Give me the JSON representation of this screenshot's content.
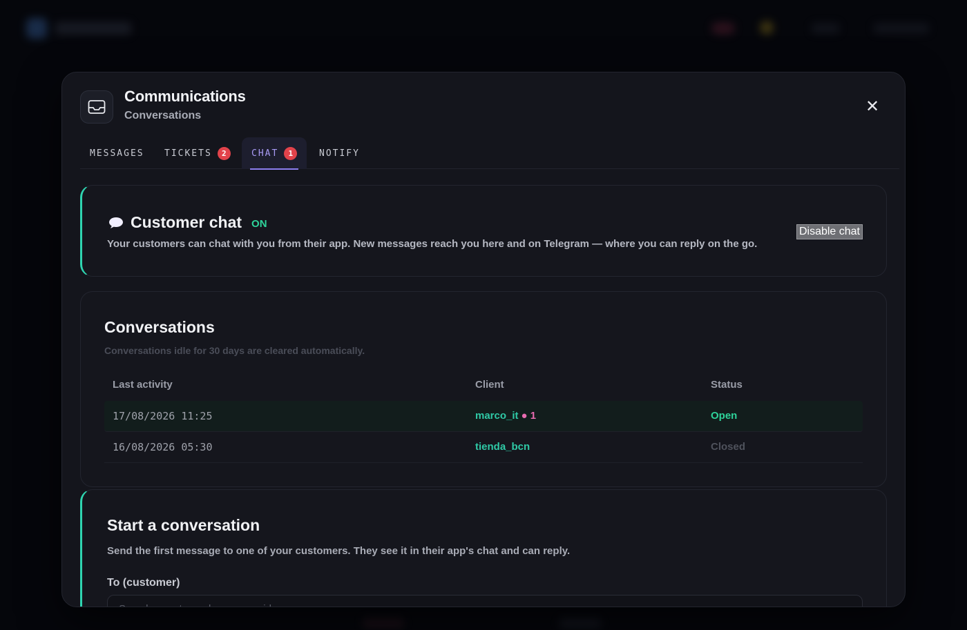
{
  "header": {
    "title": "Communications",
    "subtitle": "Conversations"
  },
  "tabs": [
    {
      "label": "MESSAGES",
      "badge": null
    },
    {
      "label": "TICKETS",
      "badge": "2"
    },
    {
      "label": "CHAT",
      "badge": "1"
    },
    {
      "label": "NOTIFY",
      "badge": null
    }
  ],
  "chat_toggle": {
    "title": "Customer chat",
    "status": "ON",
    "description": "Your customers can chat with you from their app. New messages reach you here and on Telegram — where you can reply on the go.",
    "button_label": "Disable chat"
  },
  "conversations": {
    "title": "Conversations",
    "note": "Conversations idle for 30 days are cleared automatically.",
    "columns": [
      "Last activity",
      "Client",
      "Status"
    ],
    "rows": [
      {
        "last_activity": "17/08/2026 11:25",
        "client": "marco_it",
        "unread": "● 1",
        "status": "Open"
      },
      {
        "last_activity": "16/08/2026 05:30",
        "client": "tienda_bcn",
        "unread": "",
        "status": "Closed"
      }
    ]
  },
  "start": {
    "title": "Start a conversation",
    "description": "Send the first message to one of your customers. They see it in their app's chat and can reply.",
    "to_label": "To (customer)",
    "to_placeholder": "Search a customer by name or id"
  },
  "colors": {
    "accent": "#2fd4b0",
    "tab_active": "#a99bf5",
    "open": "#2ed39a",
    "badge": "#e2434b"
  },
  "icons": {
    "header": "inbox-icon",
    "close": "close-icon",
    "chat": "speech-bubble-icon"
  }
}
